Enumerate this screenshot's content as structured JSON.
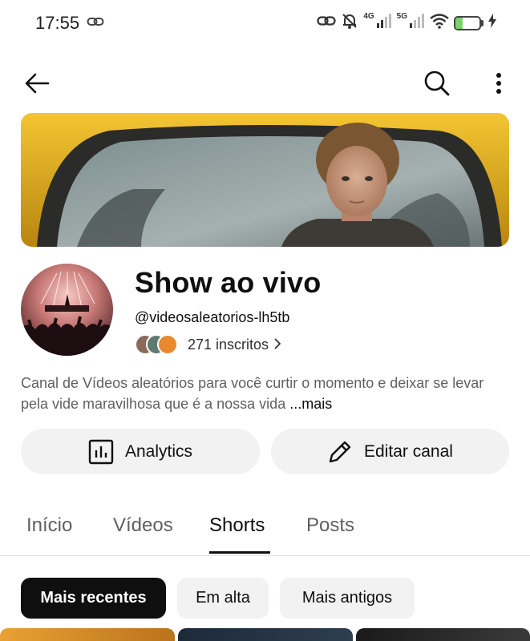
{
  "status_bar": {
    "time": "17:55",
    "network_4g": "4G",
    "network_5g": "5G",
    "battery": "10",
    "battery_level": 0.1
  },
  "top_bar": {
    "back_icon": "arrow-left-icon",
    "search_icon": "search-icon",
    "more_icon": "more-vertical-icon"
  },
  "channel": {
    "name": "Show ao vivo",
    "handle": "@videosaleatorios-lh5tb",
    "subscribers": "271 inscritos",
    "description": "Canal de Vídeos aleatórios para você curtir o momento e deixar se levar pela vide maravilhosa que é a nossa vida",
    "more": "...mais"
  },
  "actions": {
    "analytics_label": "Analytics",
    "edit_label": "Editar canal"
  },
  "tabs": [
    {
      "label": "Início",
      "active": false
    },
    {
      "label": "Vídeos",
      "active": false
    },
    {
      "label": "Shorts",
      "active": true
    },
    {
      "label": "Posts",
      "active": false
    }
  ],
  "chips": [
    {
      "label": "Mais recentes",
      "active": true
    },
    {
      "label": "Em alta",
      "active": false
    },
    {
      "label": "Mais antigos",
      "active": false
    }
  ],
  "colors": {
    "accent": "#0f0f0f",
    "chip_bg": "#f2f2f2",
    "battery_fill": "#7bd26a",
    "banner_car": "#e8b320"
  }
}
